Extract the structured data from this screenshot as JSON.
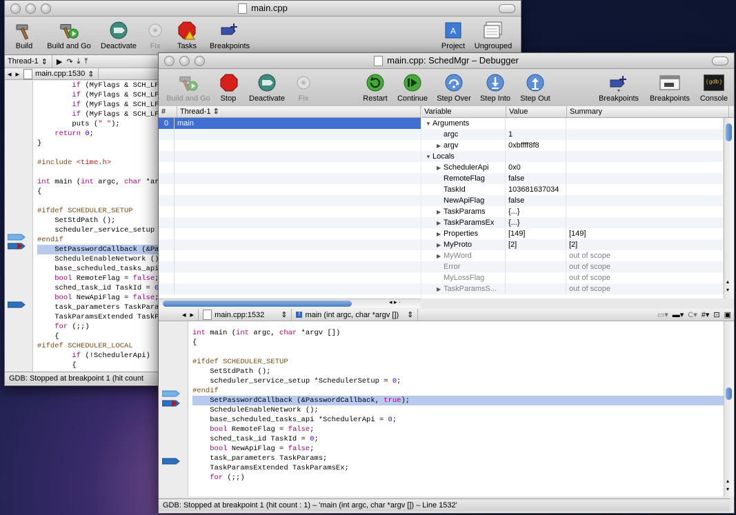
{
  "back_window": {
    "title": "main.cpp",
    "toolbar": {
      "build": "Build",
      "build_and_go": "Build and Go",
      "deactivate": "Deactivate",
      "fix": "Fix",
      "tasks": "Tasks",
      "breakpoints": "Breakpoints",
      "project": "Project",
      "ungrouped": "Ungrouped"
    },
    "thread_select": "Thread-1",
    "file_tab": "main.cpp:1530",
    "code_lines": [
      "        if (MyFlags & SCH_LF_",
      "        if (MyFlags & SCH_LF_",
      "        if (MyFlags & SCH_LF_",
      "        if (MyFlags & SCH_LF_",
      "        puts (\" \");",
      "    return 0;",
      "}",
      "",
      "#include <time.h>",
      "",
      "int main (int argc, char *argv",
      "{",
      "",
      "#ifdef SCHEDULER_SETUP",
      "    SetStdPath ();",
      "    scheduler_service_setup *S",
      "#endif",
      "    SetPasswordCallback (&Pass",
      "    ScheduleEnableNetwork ();",
      "    base_scheduled_tasks_api *",
      "    bool RemoteFlag = false;",
      "    sched_task_id TaskId = 0;",
      "    bool NewApiFlag = false;",
      "    task_parameters TaskParams",
      "    TaskParamsExtended TaskPar",
      "    for (;;)",
      "    {",
      "#ifdef SCHEDULER_LOCAL",
      "        if (!SchedulerApi)",
      "        {"
    ],
    "status": "GDB: Stopped at breakpoint 1 (hit count"
  },
  "debugger": {
    "title": "main.cpp: SchedMgr – Debugger",
    "toolbar": {
      "build_and_go": "Build and Go",
      "stop": "Stop",
      "deactivate": "Deactivate",
      "fix": "Fix",
      "restart": "Restart",
      "continue": "Continue",
      "step_over": "Step Over",
      "step_into": "Step Into",
      "step_out": "Step Out",
      "breakpoints_menu": "Breakpoints",
      "breakpoints": "Breakpoints",
      "console": "Console",
      "console_icon_text": "gdb"
    },
    "threads": {
      "col_num": "#",
      "col_thread": "Thread-1",
      "rows": [
        {
          "num": "0",
          "name": "main"
        }
      ]
    },
    "variables": {
      "col_variable": "Variable",
      "col_value": "Value",
      "col_summary": "Summary",
      "rows": [
        {
          "name": "Arguments",
          "value": "",
          "summary": "",
          "indent": 0,
          "disclosure": "open",
          "dim": false
        },
        {
          "name": "argc",
          "value": "1",
          "summary": "",
          "indent": 1,
          "disclosure": "none",
          "dim": false
        },
        {
          "name": "argv",
          "value": "0xbffff8f8",
          "summary": "",
          "indent": 1,
          "disclosure": "closed",
          "dim": false
        },
        {
          "name": "Locals",
          "value": "",
          "summary": "",
          "indent": 0,
          "disclosure": "open",
          "dim": false
        },
        {
          "name": "SchedulerApi",
          "value": "0x0",
          "summary": "",
          "indent": 1,
          "disclosure": "closed",
          "dim": false
        },
        {
          "name": "RemoteFlag",
          "value": "false",
          "summary": "",
          "indent": 1,
          "disclosure": "none",
          "dim": false
        },
        {
          "name": "TaskId",
          "value": "103681637034",
          "summary": "",
          "indent": 1,
          "disclosure": "none",
          "dim": false
        },
        {
          "name": "NewApiFlag",
          "value": "false",
          "summary": "",
          "indent": 1,
          "disclosure": "none",
          "dim": false
        },
        {
          "name": "TaskParams",
          "value": "{...}",
          "summary": "",
          "indent": 1,
          "disclosure": "closed",
          "dim": false
        },
        {
          "name": "TaskParamsEx",
          "value": "{...}",
          "summary": "",
          "indent": 1,
          "disclosure": "closed",
          "dim": false
        },
        {
          "name": "Properties",
          "value": "[149]",
          "summary": "[149]",
          "indent": 1,
          "disclosure": "closed",
          "dim": false
        },
        {
          "name": "MyProto",
          "value": "[2]",
          "summary": "[2]",
          "indent": 1,
          "disclosure": "closed",
          "dim": false
        },
        {
          "name": "MyWord",
          "value": "",
          "summary": "out of scope",
          "indent": 1,
          "disclosure": "closed",
          "dim": true
        },
        {
          "name": "Error",
          "value": "",
          "summary": "out of scope",
          "indent": 1,
          "disclosure": "none",
          "dim": true
        },
        {
          "name": "MyLossFlag",
          "value": "",
          "summary": "out of scope",
          "indent": 1,
          "disclosure": "none",
          "dim": true
        },
        {
          "name": "TaskParamsS...",
          "value": "",
          "summary": "out of scope",
          "indent": 1,
          "disclosure": "closed",
          "dim": true
        }
      ]
    },
    "editor": {
      "file_popup": "main.cpp:1532",
      "function_popup": "main (int argc, char *argv [])",
      "code_lines": [
        "int main (int argc, char *argv [])",
        "{",
        "",
        "#ifdef SCHEDULER_SETUP",
        "    SetStdPath ();",
        "    scheduler_service_setup *SchedulerSetup = 0;",
        "#endif",
        "    SetPasswordCallback (&PasswordCallback, true);",
        "    ScheduleEnableNetwork ();",
        "    base_scheduled_tasks_api *SchedulerApi = 0;",
        "    bool RemoteFlag = false;",
        "    sched_task_id TaskId = 0;",
        "    bool NewApiFlag = false;",
        "    task_parameters TaskParams;",
        "    TaskParamsExtended TaskParamsEx;",
        "    for (;;)"
      ]
    },
    "status": "GDB: Stopped at breakpoint 1 (hit count : 1) – 'main (int argc, char *argv []) – Line 1532'"
  }
}
